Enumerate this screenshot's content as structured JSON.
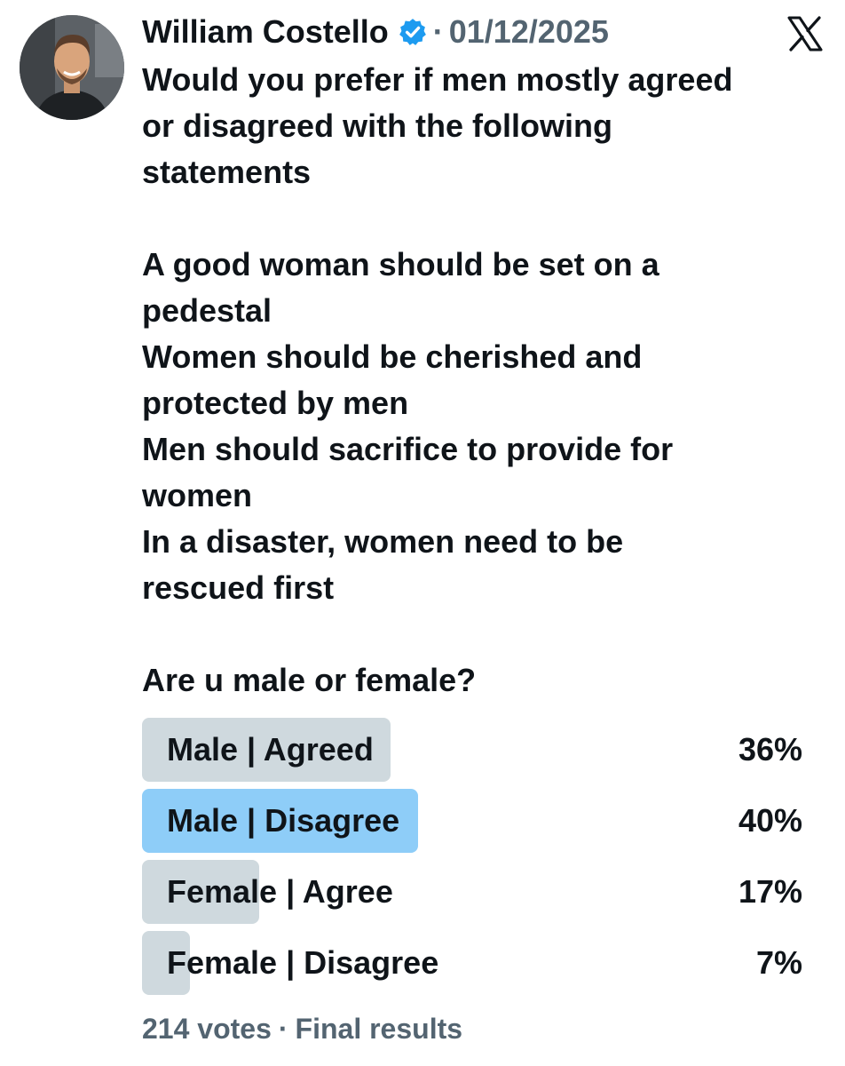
{
  "post": {
    "author_name": "William Costello",
    "separator": "·",
    "date": "01/12/2025",
    "lines": [
      "Would you prefer if men mostly agreed",
      "or disagreed with the following",
      "statements",
      "",
      "A good woman should be set on a",
      "pedestal",
      "Women should be cherished and",
      "protected by men",
      "Men should sacrifice to provide for",
      "women",
      "In a disaster, women need to be",
      "rescued first",
      "",
      "Are u male or female?"
    ]
  },
  "poll": {
    "options": [
      {
        "label": "Male | Agreed",
        "percent_text": "36%",
        "share": 0.36,
        "leader": false
      },
      {
        "label": "Male | Disagree",
        "percent_text": "40%",
        "share": 0.4,
        "leader": true
      },
      {
        "label": "Female | Agree",
        "percent_text": "17%",
        "share": 0.17,
        "leader": false
      },
      {
        "label": "Female | Disagree",
        "percent_text": "7%",
        "share": 0.07,
        "leader": false
      }
    ],
    "votes_text": "214 votes",
    "footer_separator": "·",
    "status_text": "Final results"
  },
  "colors": {
    "leader_bar": "#8ecdf8",
    "other_bar": "#cfd9de",
    "verified": "#1d9bf0",
    "muted_text": "#536471"
  },
  "icons": {
    "verified": "verified-badge-icon",
    "platform": "x-logo-icon"
  }
}
